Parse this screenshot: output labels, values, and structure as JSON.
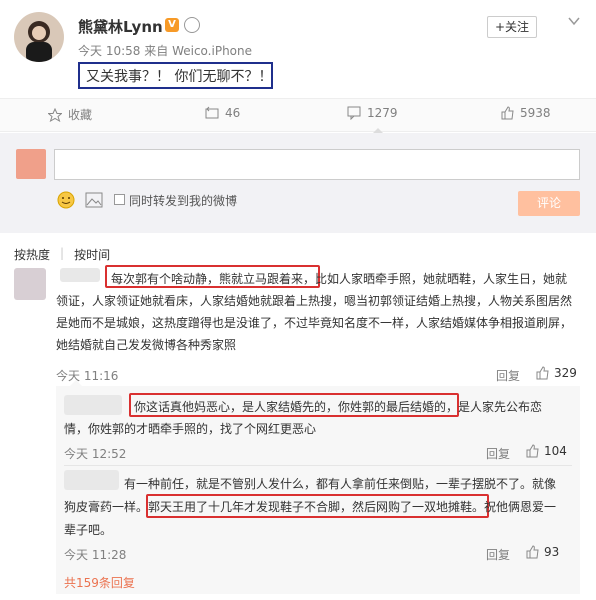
{
  "post": {
    "author": "熊黛林Lynn",
    "follow_label": "+关注",
    "time": "今天 10:58",
    "source_prefix": "来自",
    "source": "Weico.iPhone",
    "content": "又关我事？！ 你们无聊不？！"
  },
  "actions": {
    "collect": "收藏",
    "repost": "46",
    "comment": "1279",
    "like": "5938"
  },
  "compose": {
    "checkbox_label": "同时转发到我的微博",
    "submit_label": "评论"
  },
  "sort": {
    "by_heat": "按热度",
    "by_time": "按时间"
  },
  "comments": [
    {
      "lines": [
        {
          "hl": "每次郭有个啥动静，熊就立马跟着来，",
          "rest": "比如人家晒牵手照，她就晒鞋，人家生日，她就"
        },
        {
          "rest": "领证，人家领证她就看床，人家结婚她就跟着上热搜，嗯当初郭领证结婚上热搜，人物关系图居然"
        },
        {
          "rest": "是她而不是城娘，这热度蹭得也是没谁了，不过毕竟知名度不一样，人家结婚媒体争相报道刷屏，"
        },
        {
          "rest": "她结婚就自己发发微博各种秀家照"
        }
      ],
      "time": "今天 11:16",
      "reply": "回复",
      "likes": "329"
    },
    {
      "lines": [
        {
          "hl": "你这话真他妈恶心，是人家结婚先的，你姓郭的最后结婚的，",
          "rest": "是人家先公布恋"
        },
        {
          "rest": "情，你姓郭的才晒牵手照的，找了个网红更恶心"
        }
      ],
      "time": "今天 12:52",
      "reply": "回复",
      "likes": "104"
    },
    {
      "lines": [
        {
          "rest": "有一种前任，就是不管别人发什么，都有人拿前任来倒贴，一辈子摆脱不了。就像"
        },
        {
          "pre": "狗皮膏药一样。",
          "hl": "郭天王用了十几年才发现鞋子不合脚，然后网购了一双地摊鞋。",
          "rest": "祝他俩恩爱一"
        },
        {
          "rest": "辈子吧。"
        }
      ],
      "time": "今天 11:28",
      "reply": "回复",
      "likes": "93"
    }
  ],
  "more_replies": "共159条回复",
  "colors": {
    "accent_orange": "#fa7d3c",
    "highlight_red": "#d93030",
    "link_orange": "#eb7350",
    "highlight_blue": "#1f2f8c"
  }
}
